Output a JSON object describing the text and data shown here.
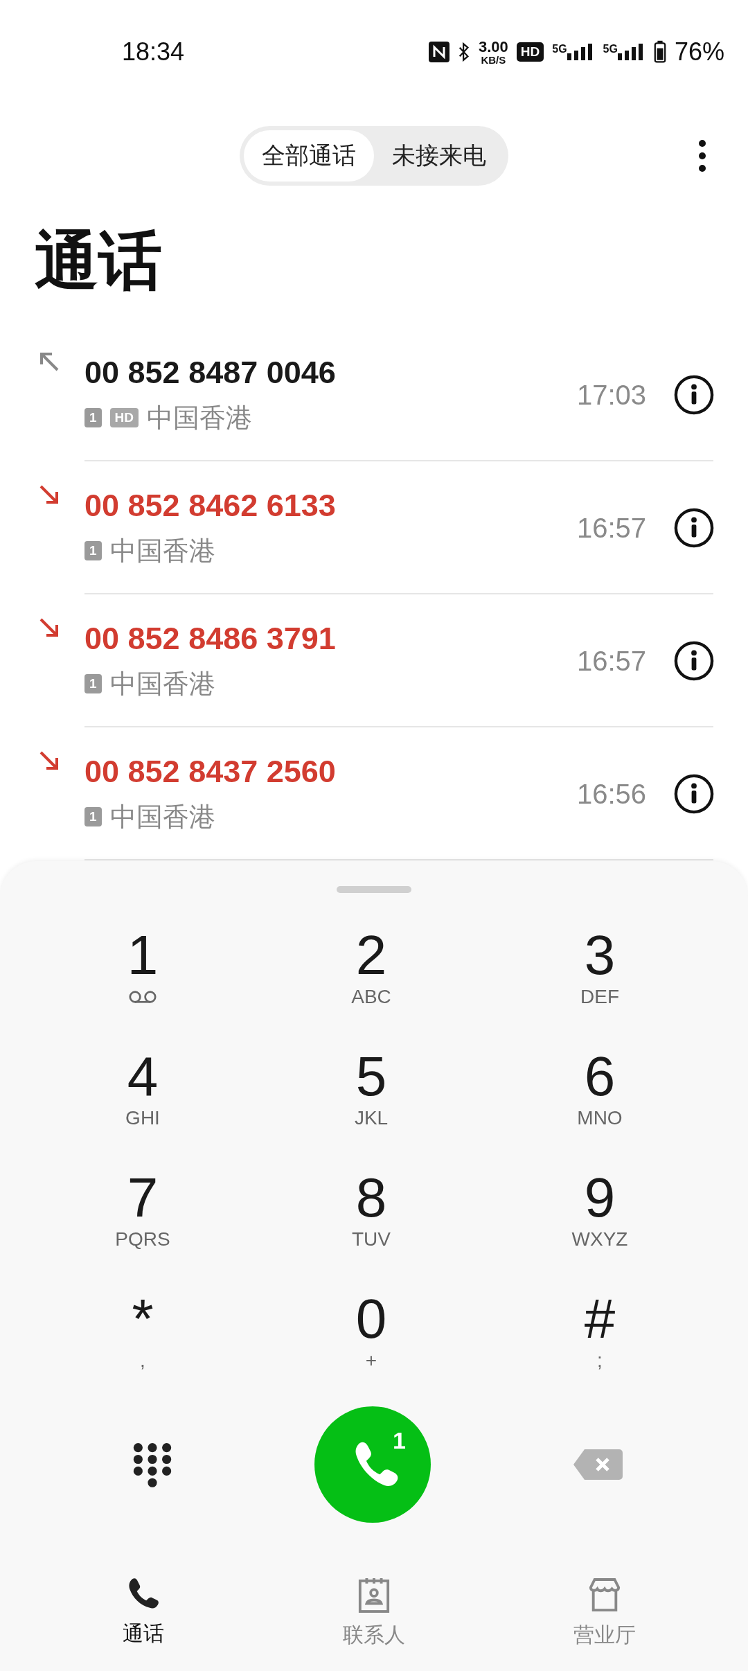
{
  "status_bar": {
    "time": "18:34",
    "speed_value": "3.00",
    "speed_unit": "KB/S",
    "hd": "HD",
    "signals": [
      {
        "label": "5G"
      },
      {
        "label": "5G"
      }
    ],
    "battery": "76%"
  },
  "tabs": [
    {
      "label": "全部通话",
      "selected": true
    },
    {
      "label": "未接来电",
      "selected": false
    }
  ],
  "title": "通话",
  "calls": [
    {
      "kind": "outgoing",
      "number": "00 852 8487 0046",
      "sim": "1",
      "hd_badge": "HD",
      "location": "中国香港",
      "time": "17:03"
    },
    {
      "kind": "missed",
      "number": "00 852 8462 6133",
      "sim": "1",
      "location": "中国香港",
      "time": "16:57"
    },
    {
      "kind": "missed",
      "number": "00 852 8486 3791",
      "sim": "1",
      "location": "中国香港",
      "time": "16:57"
    },
    {
      "kind": "missed",
      "number": "00 852 8437 2560",
      "sim": "1",
      "location": "中国香港",
      "time": "16:56"
    }
  ],
  "keypad": [
    {
      "digit": "1",
      "kind": "voicemail"
    },
    {
      "digit": "2",
      "letters": "ABC"
    },
    {
      "digit": "3",
      "letters": "DEF"
    },
    {
      "digit": "4",
      "letters": "GHI"
    },
    {
      "digit": "5",
      "letters": "JKL"
    },
    {
      "digit": "6",
      "letters": "MNO"
    },
    {
      "digit": "7",
      "letters": "PQRS"
    },
    {
      "digit": "8",
      "letters": "TUV"
    },
    {
      "digit": "9",
      "letters": "WXYZ"
    },
    {
      "digit": "*",
      "letters": ","
    },
    {
      "digit": "0",
      "letters": "+"
    },
    {
      "digit": "#",
      "letters": ";"
    }
  ],
  "call_button": {
    "sim": "1"
  },
  "nav": [
    {
      "kind": "calls",
      "label": "通话",
      "selected": true
    },
    {
      "kind": "contacts",
      "label": "联系人",
      "selected": false
    },
    {
      "kind": "store",
      "label": "营业厅",
      "selected": false
    }
  ]
}
